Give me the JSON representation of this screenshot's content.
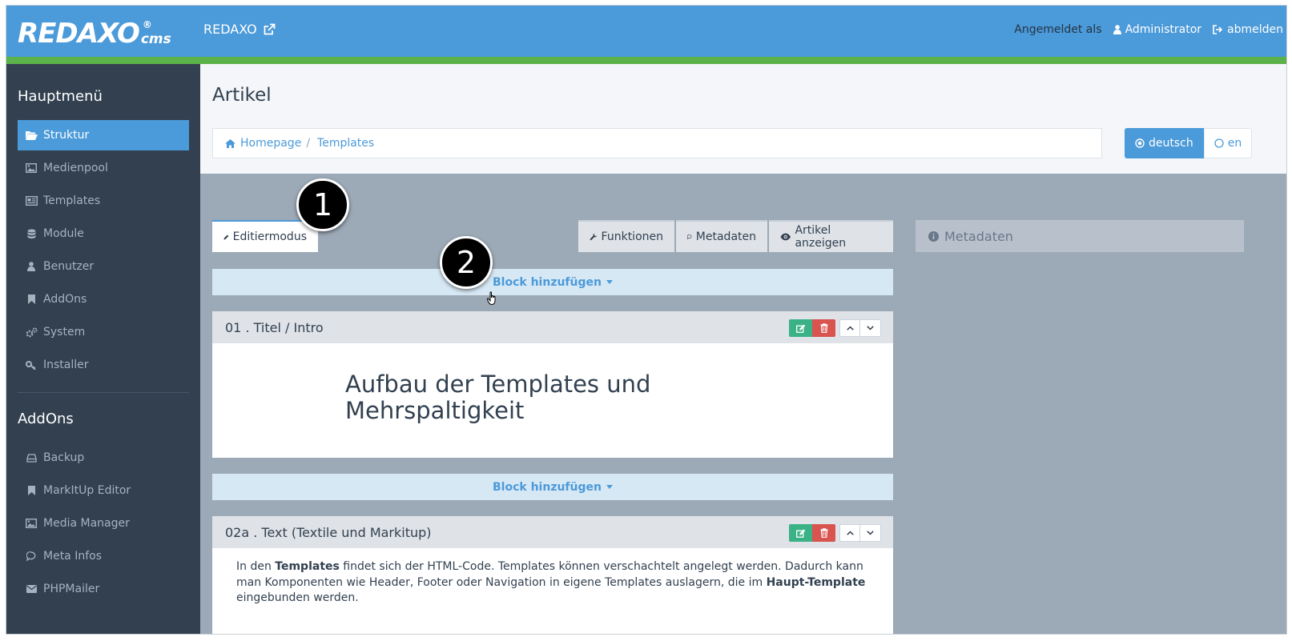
{
  "header": {
    "logo_word": "REDAXO",
    "logo_suffix": "cms",
    "logo_reg": "®",
    "site_link": "REDAXO",
    "logged_in_label": "Angemeldet als",
    "user": "Administrator",
    "logout": "abmelden"
  },
  "sidebar": {
    "main_heading": "Hauptmenü",
    "main_items": [
      {
        "label": "Struktur",
        "icon": "folder-open-icon"
      },
      {
        "label": "Medienpool",
        "icon": "image-icon"
      },
      {
        "label": "Templates",
        "icon": "newspaper-icon"
      },
      {
        "label": "Module",
        "icon": "database-icon"
      },
      {
        "label": "Benutzer",
        "icon": "user-icon"
      },
      {
        "label": "AddOns",
        "icon": "bookmark-icon"
      },
      {
        "label": "System",
        "icon": "cogs-icon"
      },
      {
        "label": "Installer",
        "icon": "key-icon"
      }
    ],
    "addons_heading": "AddOns",
    "addon_items": [
      {
        "label": "Backup",
        "icon": "hdd-icon"
      },
      {
        "label": "MarkItUp Editor",
        "icon": "bookmark-icon"
      },
      {
        "label": "Media Manager",
        "icon": "image-icon"
      },
      {
        "label": "Meta Infos",
        "icon": "comment-icon"
      },
      {
        "label": "PHPMailer",
        "icon": "envelope-icon"
      }
    ]
  },
  "page": {
    "title": "Artikel",
    "breadcrumb": [
      "Homepage",
      "Templates"
    ],
    "languages": [
      "deutsch",
      "en"
    ]
  },
  "tabs": {
    "edit": "Editiermodus",
    "functions": "Funktionen",
    "metadata": "Metadaten",
    "view": "Artikel anzeigen"
  },
  "meta_panel": "Metadaten",
  "add_block": "Block hinzufügen",
  "slices": [
    {
      "title": "01 . Titel / Intro",
      "content": "Aufbau der Templates und Mehrspaltigkeit"
    },
    {
      "title": "02a . Text (Textile und Markitup)"
    }
  ],
  "slice2_text": {
    "p1": "In den ",
    "b1": "Templates",
    "p2": " findet sich der HTML-Code. Templates können verschachtelt angelegt werden. Dadurch kann man Komponenten wie Header, Footer oder Navigation in eigene Templates auslagern, die im ",
    "b2": "Haupt-Template",
    "p3": " eingebunden werden."
  },
  "annotations": [
    "1",
    "2"
  ],
  "colors": {
    "primary": "#4b9ad9",
    "sidebar": "#324050",
    "accent_green": "#5bb14a",
    "edit_button": "#3bb286",
    "delete_button": "#d9534f"
  }
}
